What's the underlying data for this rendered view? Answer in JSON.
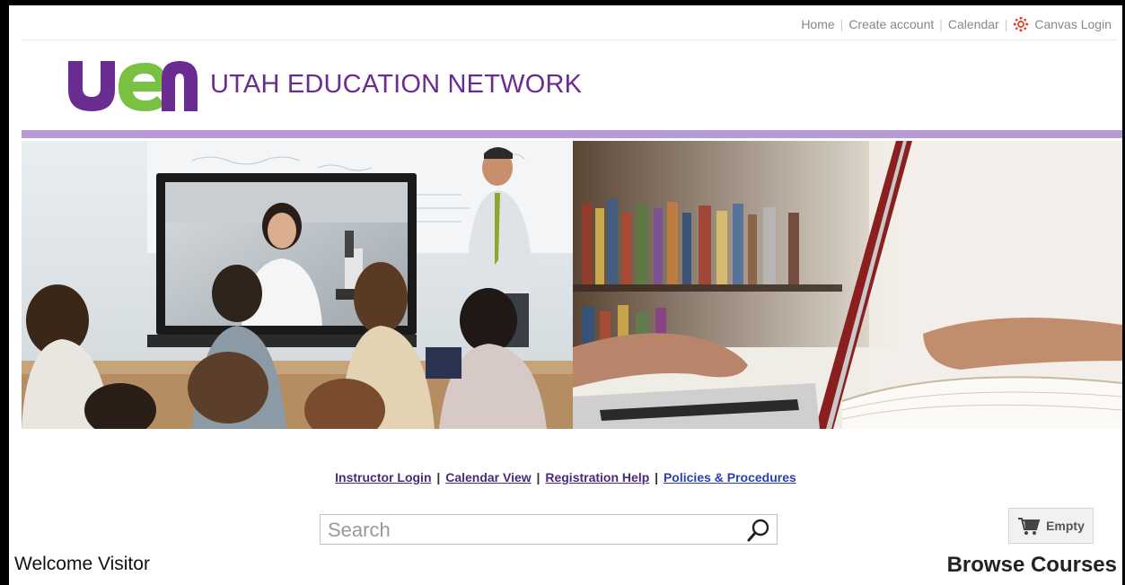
{
  "topnav": {
    "home": "Home",
    "create_account": "Create account",
    "calendar": "Calendar",
    "canvas_login": "Canvas Login",
    "separator": "|"
  },
  "brand": {
    "logo_text": "uen",
    "title": "UTAH EDUCATION NETWORK",
    "logo_purple": "#6b2c91",
    "logo_green": "#7ac143",
    "bar_color": "#b79ad6"
  },
  "links": {
    "instructor_login": "Instructor Login",
    "calendar_view": "Calendar View",
    "registration_help": "Registration Help",
    "policies": "Policies & Procedures",
    "separator": "|"
  },
  "search": {
    "placeholder": "Search"
  },
  "cart": {
    "label": "Empty"
  },
  "welcome": "Welcome Visitor",
  "browse": "Browse Courses"
}
